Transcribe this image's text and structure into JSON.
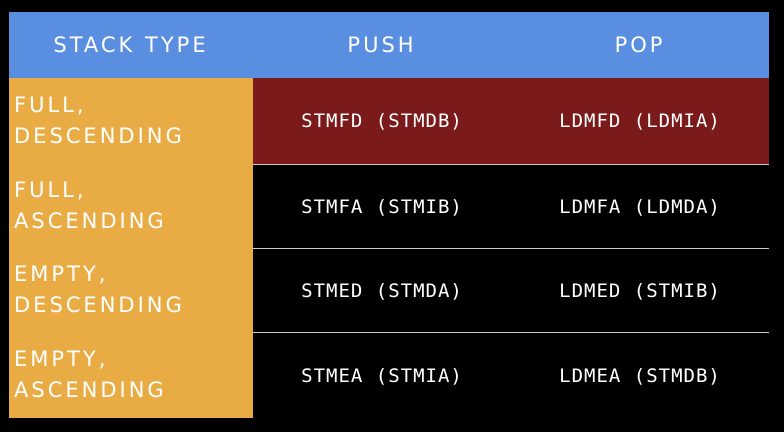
{
  "header": {
    "col1": "STACK TYPE",
    "col2": "PUSH",
    "col3": "POP"
  },
  "rows": [
    {
      "type_line1": "FULL,",
      "type_line2": "DESCENDING",
      "push": "STMFD (STMDB)",
      "pop": "LDMFD (LDMIA)",
      "highlighted": true
    },
    {
      "type_line1": "FULL,",
      "type_line2": "ASCENDING",
      "push": "STMFA (STMIB)",
      "pop": "LDMFA (LDMDA)",
      "highlighted": false
    },
    {
      "type_line1": "EMPTY,",
      "type_line2": "DESCENDING",
      "push": "STMED (STMDA)",
      "pop": "LDMED (STMIB)",
      "highlighted": false
    },
    {
      "type_line1": "EMPTY,",
      "type_line2": "ASCENDING",
      "push": "STMEA (STMIA)",
      "pop": "LDMEA (STMDB)",
      "highlighted": false
    }
  ],
  "colors": {
    "header_bg": "#5a8ee0",
    "type_col_bg": "#e9ac45",
    "highlight_row_bg": "#7a1a1a",
    "page_bg": "#000000",
    "text": "#ffffff"
  }
}
